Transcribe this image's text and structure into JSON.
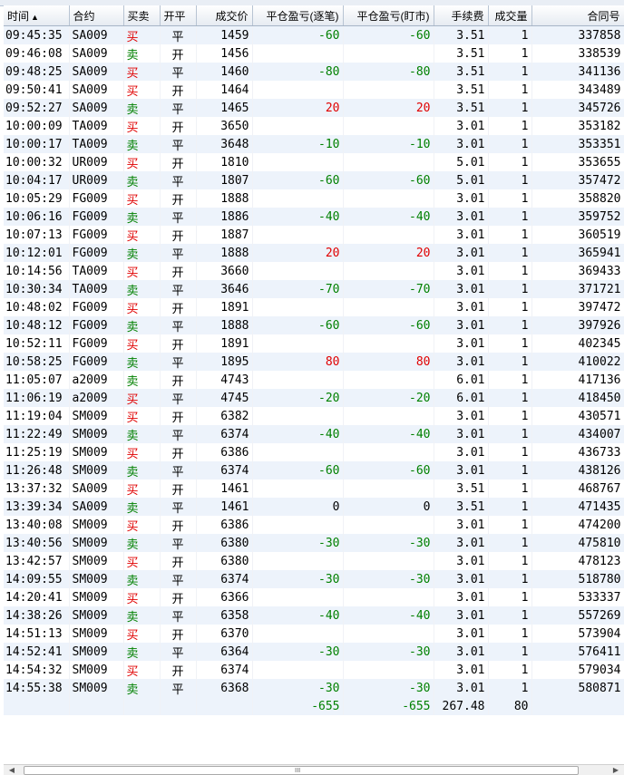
{
  "columns": {
    "time": "时间",
    "sort_arrow": "▲",
    "contract": "合约",
    "direction": "买卖",
    "open_close": "开平",
    "price": "成交价",
    "pnl_trade": "平仓盈亏(逐笔)",
    "pnl_mark": "平仓盈亏(盯市)",
    "fee": "手续费",
    "volume": "成交量",
    "order_no": "合同号"
  },
  "colors": {
    "buy": "#e00000",
    "sell": "#008000",
    "row_alt": "#edf3fb"
  },
  "rows": [
    {
      "time": "09:45:35",
      "contract": "SA009",
      "dir": "买",
      "oc": "平",
      "price": "1459",
      "pnl1": "-60",
      "pnl2": "-60",
      "fee": "3.51",
      "vol": "1",
      "no": "337858"
    },
    {
      "time": "09:46:08",
      "contract": "SA009",
      "dir": "卖",
      "oc": "开",
      "price": "1456",
      "pnl1": "",
      "pnl2": "",
      "fee": "3.51",
      "vol": "1",
      "no": "338539"
    },
    {
      "time": "09:48:25",
      "contract": "SA009",
      "dir": "买",
      "oc": "平",
      "price": "1460",
      "pnl1": "-80",
      "pnl2": "-80",
      "fee": "3.51",
      "vol": "1",
      "no": "341136"
    },
    {
      "time": "09:50:41",
      "contract": "SA009",
      "dir": "买",
      "oc": "开",
      "price": "1464",
      "pnl1": "",
      "pnl2": "",
      "fee": "3.51",
      "vol": "1",
      "no": "343489"
    },
    {
      "time": "09:52:27",
      "contract": "SA009",
      "dir": "卖",
      "oc": "平",
      "price": "1465",
      "pnl1": "20",
      "pnl2": "20",
      "fee": "3.51",
      "vol": "1",
      "no": "345726"
    },
    {
      "time": "10:00:09",
      "contract": "TA009",
      "dir": "买",
      "oc": "开",
      "price": "3650",
      "pnl1": "",
      "pnl2": "",
      "fee": "3.01",
      "vol": "1",
      "no": "353182"
    },
    {
      "time": "10:00:17",
      "contract": "TA009",
      "dir": "卖",
      "oc": "平",
      "price": "3648",
      "pnl1": "-10",
      "pnl2": "-10",
      "fee": "3.01",
      "vol": "1",
      "no": "353351"
    },
    {
      "time": "10:00:32",
      "contract": "UR009",
      "dir": "买",
      "oc": "开",
      "price": "1810",
      "pnl1": "",
      "pnl2": "",
      "fee": "5.01",
      "vol": "1",
      "no": "353655"
    },
    {
      "time": "10:04:17",
      "contract": "UR009",
      "dir": "卖",
      "oc": "平",
      "price": "1807",
      "pnl1": "-60",
      "pnl2": "-60",
      "fee": "5.01",
      "vol": "1",
      "no": "357472"
    },
    {
      "time": "10:05:29",
      "contract": "FG009",
      "dir": "买",
      "oc": "开",
      "price": "1888",
      "pnl1": "",
      "pnl2": "",
      "fee": "3.01",
      "vol": "1",
      "no": "358820"
    },
    {
      "time": "10:06:16",
      "contract": "FG009",
      "dir": "卖",
      "oc": "平",
      "price": "1886",
      "pnl1": "-40",
      "pnl2": "-40",
      "fee": "3.01",
      "vol": "1",
      "no": "359752"
    },
    {
      "time": "10:07:13",
      "contract": "FG009",
      "dir": "买",
      "oc": "开",
      "price": "1887",
      "pnl1": "",
      "pnl2": "",
      "fee": "3.01",
      "vol": "1",
      "no": "360519"
    },
    {
      "time": "10:12:01",
      "contract": "FG009",
      "dir": "卖",
      "oc": "平",
      "price": "1888",
      "pnl1": "20",
      "pnl2": "20",
      "fee": "3.01",
      "vol": "1",
      "no": "365941"
    },
    {
      "time": "10:14:56",
      "contract": "TA009",
      "dir": "买",
      "oc": "开",
      "price": "3660",
      "pnl1": "",
      "pnl2": "",
      "fee": "3.01",
      "vol": "1",
      "no": "369433"
    },
    {
      "time": "10:30:34",
      "contract": "TA009",
      "dir": "卖",
      "oc": "平",
      "price": "3646",
      "pnl1": "-70",
      "pnl2": "-70",
      "fee": "3.01",
      "vol": "1",
      "no": "371721"
    },
    {
      "time": "10:48:02",
      "contract": "FG009",
      "dir": "买",
      "oc": "开",
      "price": "1891",
      "pnl1": "",
      "pnl2": "",
      "fee": "3.01",
      "vol": "1",
      "no": "397472"
    },
    {
      "time": "10:48:12",
      "contract": "FG009",
      "dir": "卖",
      "oc": "平",
      "price": "1888",
      "pnl1": "-60",
      "pnl2": "-60",
      "fee": "3.01",
      "vol": "1",
      "no": "397926"
    },
    {
      "time": "10:52:11",
      "contract": "FG009",
      "dir": "买",
      "oc": "开",
      "price": "1891",
      "pnl1": "",
      "pnl2": "",
      "fee": "3.01",
      "vol": "1",
      "no": "402345"
    },
    {
      "time": "10:58:25",
      "contract": "FG009",
      "dir": "卖",
      "oc": "平",
      "price": "1895",
      "pnl1": "80",
      "pnl2": "80",
      "fee": "3.01",
      "vol": "1",
      "no": "410022"
    },
    {
      "time": "11:05:07",
      "contract": "a2009",
      "dir": "卖",
      "oc": "开",
      "price": "4743",
      "pnl1": "",
      "pnl2": "",
      "fee": "6.01",
      "vol": "1",
      "no": "417136"
    },
    {
      "time": "11:06:19",
      "contract": "a2009",
      "dir": "买",
      "oc": "平",
      "price": "4745",
      "pnl1": "-20",
      "pnl2": "-20",
      "fee": "6.01",
      "vol": "1",
      "no": "418450"
    },
    {
      "time": "11:19:04",
      "contract": "SM009",
      "dir": "买",
      "oc": "开",
      "price": "6382",
      "pnl1": "",
      "pnl2": "",
      "fee": "3.01",
      "vol": "1",
      "no": "430571"
    },
    {
      "time": "11:22:49",
      "contract": "SM009",
      "dir": "卖",
      "oc": "平",
      "price": "6374",
      "pnl1": "-40",
      "pnl2": "-40",
      "fee": "3.01",
      "vol": "1",
      "no": "434007"
    },
    {
      "time": "11:25:19",
      "contract": "SM009",
      "dir": "买",
      "oc": "开",
      "price": "6386",
      "pnl1": "",
      "pnl2": "",
      "fee": "3.01",
      "vol": "1",
      "no": "436733"
    },
    {
      "time": "11:26:48",
      "contract": "SM009",
      "dir": "卖",
      "oc": "平",
      "price": "6374",
      "pnl1": "-60",
      "pnl2": "-60",
      "fee": "3.01",
      "vol": "1",
      "no": "438126"
    },
    {
      "time": "13:37:32",
      "contract": "SA009",
      "dir": "买",
      "oc": "开",
      "price": "1461",
      "pnl1": "",
      "pnl2": "",
      "fee": "3.51",
      "vol": "1",
      "no": "468767"
    },
    {
      "time": "13:39:34",
      "contract": "SA009",
      "dir": "卖",
      "oc": "平",
      "price": "1461",
      "pnl1": "0",
      "pnl2": "0",
      "fee": "3.51",
      "vol": "1",
      "no": "471435"
    },
    {
      "time": "13:40:08",
      "contract": "SM009",
      "dir": "买",
      "oc": "开",
      "price": "6386",
      "pnl1": "",
      "pnl2": "",
      "fee": "3.01",
      "vol": "1",
      "no": "474200"
    },
    {
      "time": "13:40:56",
      "contract": "SM009",
      "dir": "卖",
      "oc": "平",
      "price": "6380",
      "pnl1": "-30",
      "pnl2": "-30",
      "fee": "3.01",
      "vol": "1",
      "no": "475810"
    },
    {
      "time": "13:42:57",
      "contract": "SM009",
      "dir": "买",
      "oc": "开",
      "price": "6380",
      "pnl1": "",
      "pnl2": "",
      "fee": "3.01",
      "vol": "1",
      "no": "478123"
    },
    {
      "time": "14:09:55",
      "contract": "SM009",
      "dir": "卖",
      "oc": "平",
      "price": "6374",
      "pnl1": "-30",
      "pnl2": "-30",
      "fee": "3.01",
      "vol": "1",
      "no": "518780"
    },
    {
      "time": "14:20:41",
      "contract": "SM009",
      "dir": "买",
      "oc": "开",
      "price": "6366",
      "pnl1": "",
      "pnl2": "",
      "fee": "3.01",
      "vol": "1",
      "no": "533337"
    },
    {
      "time": "14:38:26",
      "contract": "SM009",
      "dir": "卖",
      "oc": "平",
      "price": "6358",
      "pnl1": "-40",
      "pnl2": "-40",
      "fee": "3.01",
      "vol": "1",
      "no": "557269"
    },
    {
      "time": "14:51:13",
      "contract": "SM009",
      "dir": "买",
      "oc": "开",
      "price": "6370",
      "pnl1": "",
      "pnl2": "",
      "fee": "3.01",
      "vol": "1",
      "no": "573904"
    },
    {
      "time": "14:52:41",
      "contract": "SM009",
      "dir": "卖",
      "oc": "平",
      "price": "6364",
      "pnl1": "-30",
      "pnl2": "-30",
      "fee": "3.01",
      "vol": "1",
      "no": "576411"
    },
    {
      "time": "14:54:32",
      "contract": "SM009",
      "dir": "买",
      "oc": "开",
      "price": "6374",
      "pnl1": "",
      "pnl2": "",
      "fee": "3.01",
      "vol": "1",
      "no": "579034"
    },
    {
      "time": "14:55:38",
      "contract": "SM009",
      "dir": "卖",
      "oc": "平",
      "price": "6368",
      "pnl1": "-30",
      "pnl2": "-30",
      "fee": "3.01",
      "vol": "1",
      "no": "580871"
    }
  ],
  "totals": {
    "pnl1": "-655",
    "pnl2": "-655",
    "fee": "267.48",
    "vol": "80"
  },
  "scrollbar": {
    "grip": "III"
  }
}
